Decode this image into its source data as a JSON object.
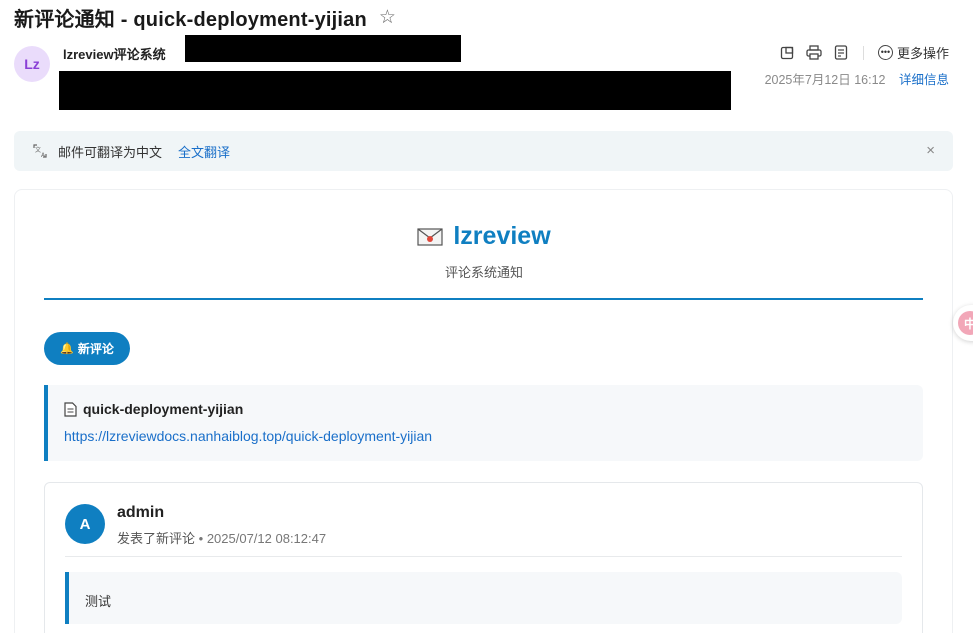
{
  "email": {
    "subject": "新评论通知 - quick-deployment-yijian",
    "star_glyph": "☆",
    "sender_avatar": "Lz",
    "sender_name": "lzreview评论系统",
    "date": "2025年7月12日 16:12",
    "detail_label": "详细信息",
    "more_label": "更多操作"
  },
  "translate": {
    "text": "邮件可翻译为中文",
    "link": "全文翻译",
    "close_glyph": "×"
  },
  "content": {
    "brand_name": "lzreview",
    "brand_sub": "评论系统通知",
    "badge": "新评论",
    "post_title": "quick-deployment-yijian",
    "post_url": "https://lzreviewdocs.nanhaiblog.top/quick-deployment-yijian",
    "comment": {
      "avatar": "A",
      "author": "admin",
      "action": "发表了新评论",
      "time": "2025/07/12 08:12:47",
      "text": "测试"
    }
  },
  "float_tab": {
    "label": "中"
  },
  "colors": {
    "accent": "#0f7fc1",
    "link": "#1a6fc9",
    "avatar_bg": "#eadcfb",
    "avatar_fg": "#8a3fd6"
  },
  "icons": [
    "star-icon",
    "open-window-icon",
    "print-icon",
    "note-icon",
    "more-dots-icon",
    "translate-icon",
    "close-icon",
    "envelope-icon",
    "bell-icon",
    "document-icon"
  ]
}
